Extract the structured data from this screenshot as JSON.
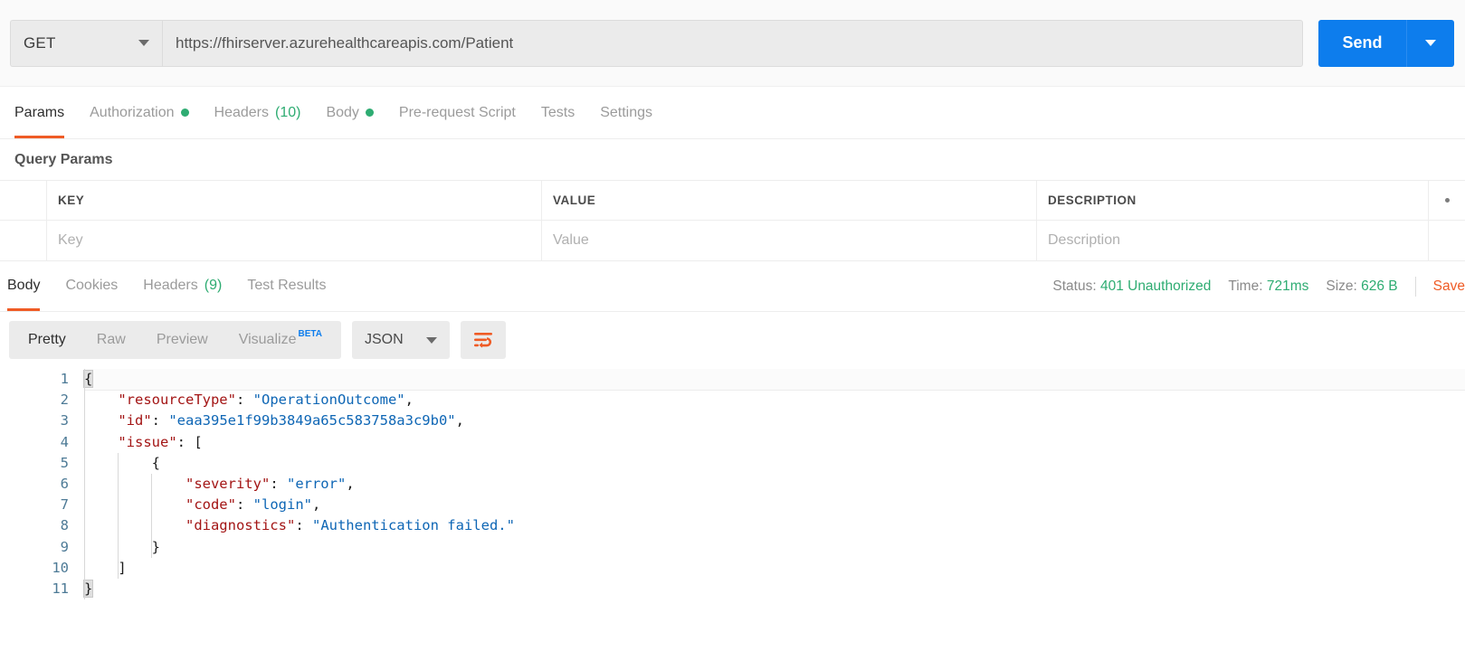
{
  "request": {
    "method": "GET",
    "url": "https://fhirserver.azurehealthcareapis.com/Patient",
    "send_label": "Send"
  },
  "request_tabs": [
    {
      "label": "Params",
      "badge": "",
      "dot": false,
      "active": true
    },
    {
      "label": "Authorization",
      "badge": "",
      "dot": true,
      "active": false
    },
    {
      "label": "Headers",
      "badge": "(10)",
      "dot": false,
      "active": false
    },
    {
      "label": "Body",
      "badge": "",
      "dot": true,
      "active": false
    },
    {
      "label": "Pre-request Script",
      "badge": "",
      "dot": false,
      "active": false
    },
    {
      "label": "Tests",
      "badge": "",
      "dot": false,
      "active": false
    },
    {
      "label": "Settings",
      "badge": "",
      "dot": false,
      "active": false
    }
  ],
  "query_params": {
    "title": "Query Params",
    "columns": [
      "KEY",
      "VALUE",
      "DESCRIPTION"
    ],
    "placeholders": {
      "key": "Key",
      "value": "Value",
      "description": "Description"
    }
  },
  "response_tabs": [
    {
      "label": "Body",
      "badge": "",
      "active": true
    },
    {
      "label": "Cookies",
      "badge": "",
      "active": false
    },
    {
      "label": "Headers",
      "badge": "(9)",
      "active": false
    },
    {
      "label": "Test Results",
      "badge": "",
      "active": false
    }
  ],
  "response_meta": {
    "status_label": "Status:",
    "status_value": "401 Unauthorized",
    "time_label": "Time:",
    "time_value": "721ms",
    "size_label": "Size:",
    "size_value": "626 B",
    "save_label": "Save"
  },
  "view_modes": [
    {
      "label": "Pretty",
      "active": true
    },
    {
      "label": "Raw",
      "active": false
    },
    {
      "label": "Preview",
      "active": false
    },
    {
      "label": "Visualize",
      "active": false,
      "beta": "BETA"
    }
  ],
  "format_select": {
    "value": "JSON"
  },
  "body": {
    "lines": [
      {
        "n": "1",
        "indent": 0,
        "tokens": [
          {
            "t": "{",
            "c": "p"
          }
        ]
      },
      {
        "n": "2",
        "indent": 1,
        "tokens": [
          {
            "t": "\"resourceType\"",
            "c": "k"
          },
          {
            "t": ": ",
            "c": "p"
          },
          {
            "t": "\"OperationOutcome\"",
            "c": "s"
          },
          {
            "t": ",",
            "c": "p"
          }
        ]
      },
      {
        "n": "3",
        "indent": 1,
        "tokens": [
          {
            "t": "\"id\"",
            "c": "k"
          },
          {
            "t": ": ",
            "c": "p"
          },
          {
            "t": "\"eaa395e1f99b3849a65c583758a3c9b0\"",
            "c": "s"
          },
          {
            "t": ",",
            "c": "p"
          }
        ]
      },
      {
        "n": "4",
        "indent": 1,
        "tokens": [
          {
            "t": "\"issue\"",
            "c": "k"
          },
          {
            "t": ": ",
            "c": "p"
          },
          {
            "t": "[",
            "c": "p"
          }
        ]
      },
      {
        "n": "5",
        "indent": 2,
        "tokens": [
          {
            "t": "{",
            "c": "p"
          }
        ]
      },
      {
        "n": "6",
        "indent": 3,
        "tokens": [
          {
            "t": "\"severity\"",
            "c": "k"
          },
          {
            "t": ": ",
            "c": "p"
          },
          {
            "t": "\"error\"",
            "c": "s"
          },
          {
            "t": ",",
            "c": "p"
          }
        ]
      },
      {
        "n": "7",
        "indent": 3,
        "tokens": [
          {
            "t": "\"code\"",
            "c": "k"
          },
          {
            "t": ": ",
            "c": "p"
          },
          {
            "t": "\"login\"",
            "c": "s"
          },
          {
            "t": ",",
            "c": "p"
          }
        ]
      },
      {
        "n": "8",
        "indent": 3,
        "tokens": [
          {
            "t": "\"diagnostics\"",
            "c": "k"
          },
          {
            "t": ": ",
            "c": "p"
          },
          {
            "t": "\"Authentication failed.\"",
            "c": "s"
          }
        ]
      },
      {
        "n": "9",
        "indent": 2,
        "tokens": [
          {
            "t": "}",
            "c": "p"
          }
        ]
      },
      {
        "n": "10",
        "indent": 1,
        "tokens": [
          {
            "t": "]",
            "c": "p"
          }
        ]
      },
      {
        "n": "11",
        "indent": 0,
        "tokens": [
          {
            "t": "}",
            "c": "p"
          }
        ]
      }
    ]
  },
  "colors": {
    "accent_orange": "#ef5b25",
    "send_blue": "#0d7ded",
    "status_green": "#2eac72",
    "json_key": "#a31515",
    "json_string": "#0e66b5",
    "gutter": "#4d7a96"
  }
}
